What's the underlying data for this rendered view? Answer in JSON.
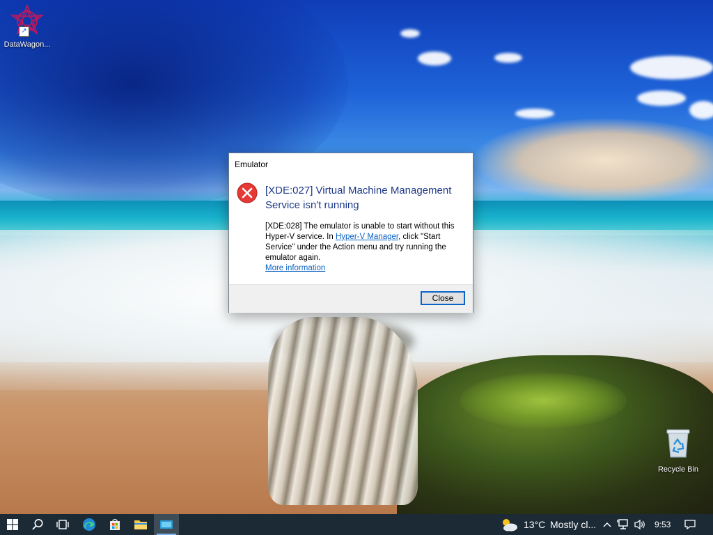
{
  "desktop": {
    "icons": [
      {
        "label": "DataWagon..."
      },
      {
        "label": "Recycle Bin"
      }
    ]
  },
  "dialog": {
    "window_title": "Emulator",
    "main_instruction": "[XDE:027] Virtual Machine Management Service isn't running",
    "content_before_link": "[XDE:028] The emulator is unable to start without this Hyper-V service. In ",
    "content_link": "Hyper-V Manager",
    "content_after_link": ", click \"Start Service\" under the Action menu and try running the emulator again.",
    "more_info_link": "More information",
    "close_button": "Close"
  },
  "taskbar": {
    "apps": [
      {
        "icon": "windows-start-icon"
      },
      {
        "icon": "search-icon"
      },
      {
        "icon": "task-view-icon"
      },
      {
        "icon": "edge-browser-icon"
      },
      {
        "icon": "store-icon"
      },
      {
        "icon": "file-explorer-icon"
      },
      {
        "icon": "emulator-app-icon"
      }
    ],
    "weather": {
      "temperature": "13°C",
      "condition": "Mostly cl..."
    },
    "clock": "9:53"
  },
  "colors": {
    "taskbar_bg": "#1b2a35",
    "dialog_heading": "#1e3a8a",
    "link": "#0b62c4",
    "error_red": "#e53935",
    "button_focus_border": "#0a64c8"
  }
}
